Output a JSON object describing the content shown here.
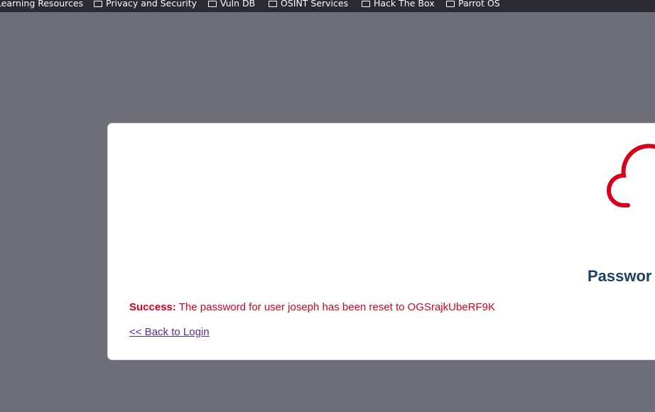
{
  "bookmarks": [
    {
      "label": "Learning Resources",
      "has_icon": false
    },
    {
      "label": "Privacy and Security",
      "has_icon": true
    },
    {
      "label": "Vuln DB",
      "has_icon": true
    },
    {
      "label": "OSINT Services",
      "has_icon": true
    },
    {
      "label": "Hack The Box",
      "has_icon": true
    },
    {
      "label": "Parrot OS",
      "has_icon": true
    }
  ],
  "card": {
    "title": "Passwor",
    "message_label": "Success:",
    "message_text": " The password for user joseph has been reset to OGSrajkUbeRF9K",
    "back_link": "<< Back to Login"
  },
  "colors": {
    "accent_red": "#d9001b",
    "title_blue": "#1f3f63",
    "link_purple": "#5a2a9c"
  }
}
